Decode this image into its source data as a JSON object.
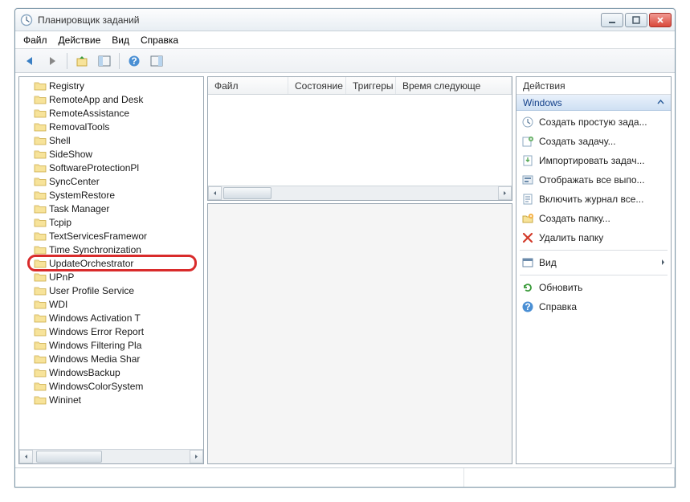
{
  "window": {
    "title": "Планировщик заданий"
  },
  "menu": {
    "file": "Файл",
    "action": "Действие",
    "view": "Вид",
    "help": "Справка"
  },
  "tree": {
    "items": [
      {
        "label": "Registry"
      },
      {
        "label": "RemoteApp and Desk"
      },
      {
        "label": "RemoteAssistance"
      },
      {
        "label": "RemovalTools"
      },
      {
        "label": "Shell"
      },
      {
        "label": "SideShow"
      },
      {
        "label": "SoftwareProtectionPl"
      },
      {
        "label": "SyncCenter"
      },
      {
        "label": "SystemRestore"
      },
      {
        "label": "Task Manager"
      },
      {
        "label": "Tcpip"
      },
      {
        "label": "TextServicesFramewor"
      },
      {
        "label": "Time Synchronization"
      },
      {
        "label": "UpdateOrchestrator",
        "highlight": true
      },
      {
        "label": "UPnP"
      },
      {
        "label": "User Profile Service"
      },
      {
        "label": "WDI"
      },
      {
        "label": "Windows Activation T"
      },
      {
        "label": "Windows Error Report"
      },
      {
        "label": "Windows Filtering Pla"
      },
      {
        "label": "Windows Media Shar"
      },
      {
        "label": "WindowsBackup"
      },
      {
        "label": "WindowsColorSystem"
      },
      {
        "label": "Wininet"
      }
    ]
  },
  "list": {
    "columns": {
      "file": "Файл",
      "state": "Состояние",
      "triggers": "Триггеры",
      "nextrun": "Время следующе"
    }
  },
  "actions": {
    "title": "Действия",
    "group": "Windows",
    "items": [
      {
        "icon": "task-icon",
        "label": "Создать простую зада..."
      },
      {
        "icon": "task-new-icon",
        "label": "Создать задачу..."
      },
      {
        "icon": "import-icon",
        "label": "Импортировать задач..."
      },
      {
        "icon": "running-icon",
        "label": "Отображать все выпо..."
      },
      {
        "icon": "log-icon",
        "label": "Включить журнал все..."
      },
      {
        "icon": "new-folder-icon",
        "label": "Создать папку..."
      },
      {
        "icon": "delete-icon",
        "label": "Удалить папку"
      }
    ],
    "bottom": [
      {
        "icon": "view-icon",
        "label": "Вид",
        "submenu": true
      },
      {
        "icon": "refresh-icon",
        "label": "Обновить"
      },
      {
        "icon": "help-icon",
        "label": "Справка"
      }
    ]
  }
}
